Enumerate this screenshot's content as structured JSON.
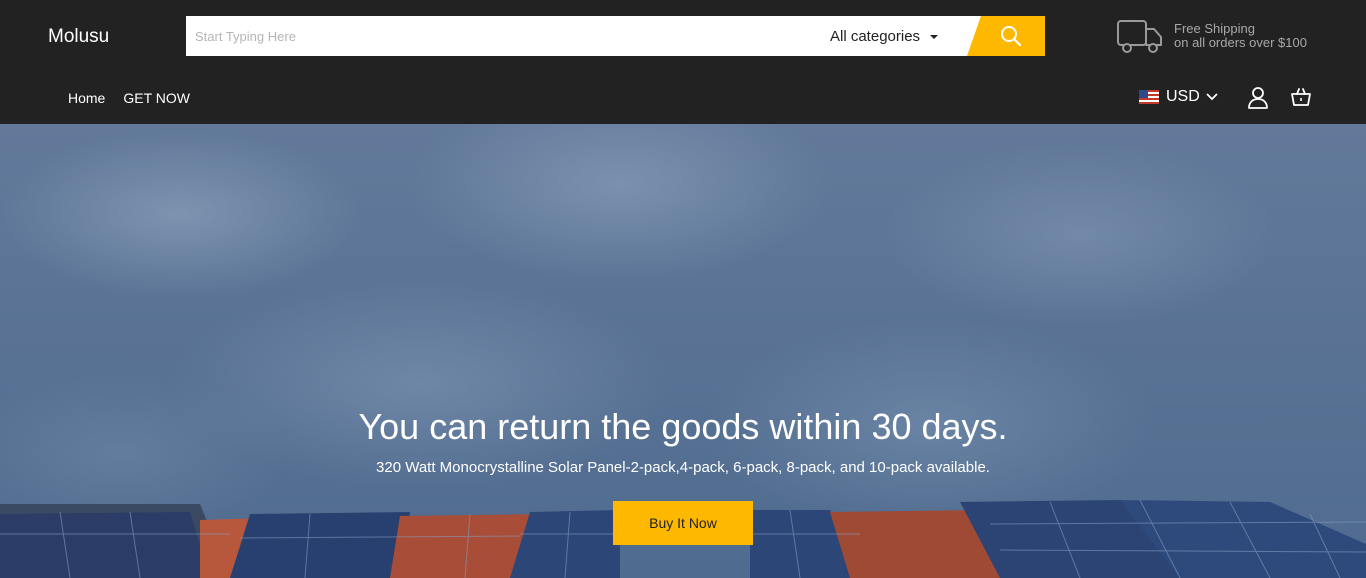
{
  "brand": {
    "name": "Molusu"
  },
  "search": {
    "placeholder": "Start Typing Here",
    "category_label": "All categories"
  },
  "shipping": {
    "line1": "Free Shipping",
    "line2": "on all orders over $100"
  },
  "nav": {
    "items": [
      {
        "label": "Home"
      },
      {
        "label": "GET NOW"
      }
    ]
  },
  "currency": {
    "label": "USD",
    "flag": "us-flag-icon"
  },
  "icons": {
    "search": "search-icon",
    "truck": "truck-icon",
    "user": "user-icon",
    "cart": "basket-icon",
    "chevron": "chevron-down-icon"
  },
  "hero": {
    "title": "You can return the goods within 30 days.",
    "subtitle": "320 Watt Monocrystalline Solar Panel-2-pack,4-pack, 6-pack, 8-pack, and 10-pack available.",
    "button_label": "Buy It Now"
  },
  "colors": {
    "header_bg": "#222222",
    "accent": "#FFB800",
    "muted_text": "#a8a8a8"
  }
}
